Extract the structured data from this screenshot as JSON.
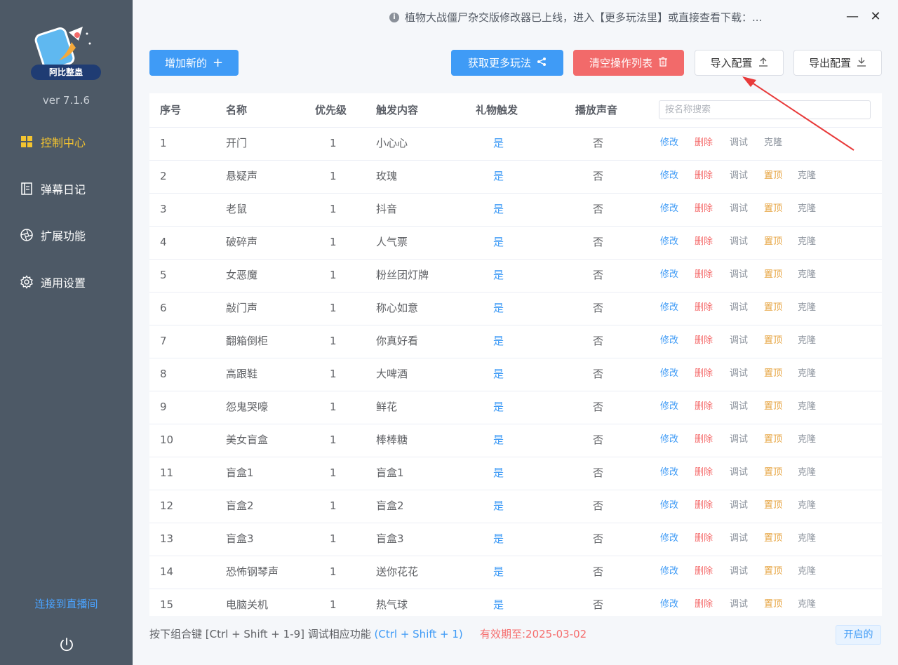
{
  "sidebar": {
    "logo_text": "阿比整蛊",
    "version": "ver 7.1.6",
    "items": [
      {
        "label": "控制中心",
        "icon": "grid-icon",
        "active": true
      },
      {
        "label": "弹幕日记",
        "icon": "document-icon",
        "active": false
      },
      {
        "label": "扩展功能",
        "icon": "aperture-icon",
        "active": false
      },
      {
        "label": "通用设置",
        "icon": "gear-icon",
        "active": false
      }
    ],
    "connect_label": "连接到直播间",
    "power_icon": "power-icon"
  },
  "header": {
    "notice": "植物大战僵尸杂交版修改器已上线，进入【更多玩法里】或直接查看下载：...",
    "notice_icon": "info-icon",
    "minimize_label": "—",
    "close_label": "✕"
  },
  "toolbar": {
    "add_label": "增加新的",
    "add_icon": "+",
    "more_label": "获取更多玩法",
    "more_icon": "share-icon",
    "clear_label": "清空操作列表",
    "clear_icon": "trash-icon",
    "import_label": "导入配置",
    "import_icon": "upload-icon",
    "export_label": "导出配置",
    "export_icon": "download-icon"
  },
  "table": {
    "columns": [
      "序号",
      "名称",
      "优先级",
      "触发内容",
      "礼物触发",
      "播放声音"
    ],
    "search_placeholder": "按名称搜索",
    "actions": {
      "edit": "修改",
      "delete": "删除",
      "debug": "调试",
      "top": "置顶",
      "clone": "克隆"
    },
    "rows": [
      {
        "id": "1",
        "name": "开门",
        "priority": "1",
        "trigger": "小心心",
        "gift": "是",
        "sound": "否",
        "can_top": false
      },
      {
        "id": "2",
        "name": "悬疑声",
        "priority": "1",
        "trigger": "玫瑰",
        "gift": "是",
        "sound": "否",
        "can_top": true
      },
      {
        "id": "3",
        "name": "老鼠",
        "priority": "1",
        "trigger": "抖音",
        "gift": "是",
        "sound": "否",
        "can_top": true
      },
      {
        "id": "4",
        "name": "破碎声",
        "priority": "1",
        "trigger": "人气票",
        "gift": "是",
        "sound": "否",
        "can_top": true
      },
      {
        "id": "5",
        "name": "女恶魔",
        "priority": "1",
        "trigger": "粉丝团灯牌",
        "gift": "是",
        "sound": "否",
        "can_top": true
      },
      {
        "id": "6",
        "name": "敲门声",
        "priority": "1",
        "trigger": "称心如意",
        "gift": "是",
        "sound": "否",
        "can_top": true
      },
      {
        "id": "7",
        "name": "翻箱倒柜",
        "priority": "1",
        "trigger": "你真好看",
        "gift": "是",
        "sound": "否",
        "can_top": true
      },
      {
        "id": "8",
        "name": "高跟鞋",
        "priority": "1",
        "trigger": "大啤酒",
        "gift": "是",
        "sound": "否",
        "can_top": true
      },
      {
        "id": "9",
        "name": "怨鬼哭嚎",
        "priority": "1",
        "trigger": "鲜花",
        "gift": "是",
        "sound": "否",
        "can_top": true
      },
      {
        "id": "10",
        "name": "美女盲盒",
        "priority": "1",
        "trigger": "棒棒糖",
        "gift": "是",
        "sound": "否",
        "can_top": true
      },
      {
        "id": "11",
        "name": "盲盒1",
        "priority": "1",
        "trigger": "盲盒1",
        "gift": "是",
        "sound": "否",
        "can_top": true
      },
      {
        "id": "12",
        "name": "盲盒2",
        "priority": "1",
        "trigger": "盲盒2",
        "gift": "是",
        "sound": "否",
        "can_top": true
      },
      {
        "id": "13",
        "name": "盲盒3",
        "priority": "1",
        "trigger": "盲盒3",
        "gift": "是",
        "sound": "否",
        "can_top": true
      },
      {
        "id": "14",
        "name": "恐怖钢琴声",
        "priority": "1",
        "trigger": "送你花花",
        "gift": "是",
        "sound": "否",
        "can_top": true
      },
      {
        "id": "15",
        "name": "电脑关机",
        "priority": "1",
        "trigger": "热气球",
        "gift": "是",
        "sound": "否",
        "can_top": true
      }
    ]
  },
  "footer": {
    "hint_prefix": "按下组合键 [Ctrl + Shift + 1-9] 调试相应功能",
    "hint_example": "(Ctrl + Shift + 1)",
    "expiry": "有效期至:2025-03-02",
    "status_label": "开启的"
  },
  "colors": {
    "sidebar_bg": "#4d5966",
    "accent_blue": "#3f9bf6",
    "danger_red": "#f26a6a",
    "active_yellow": "#f4c430",
    "warning_orange": "#e6a23c"
  }
}
